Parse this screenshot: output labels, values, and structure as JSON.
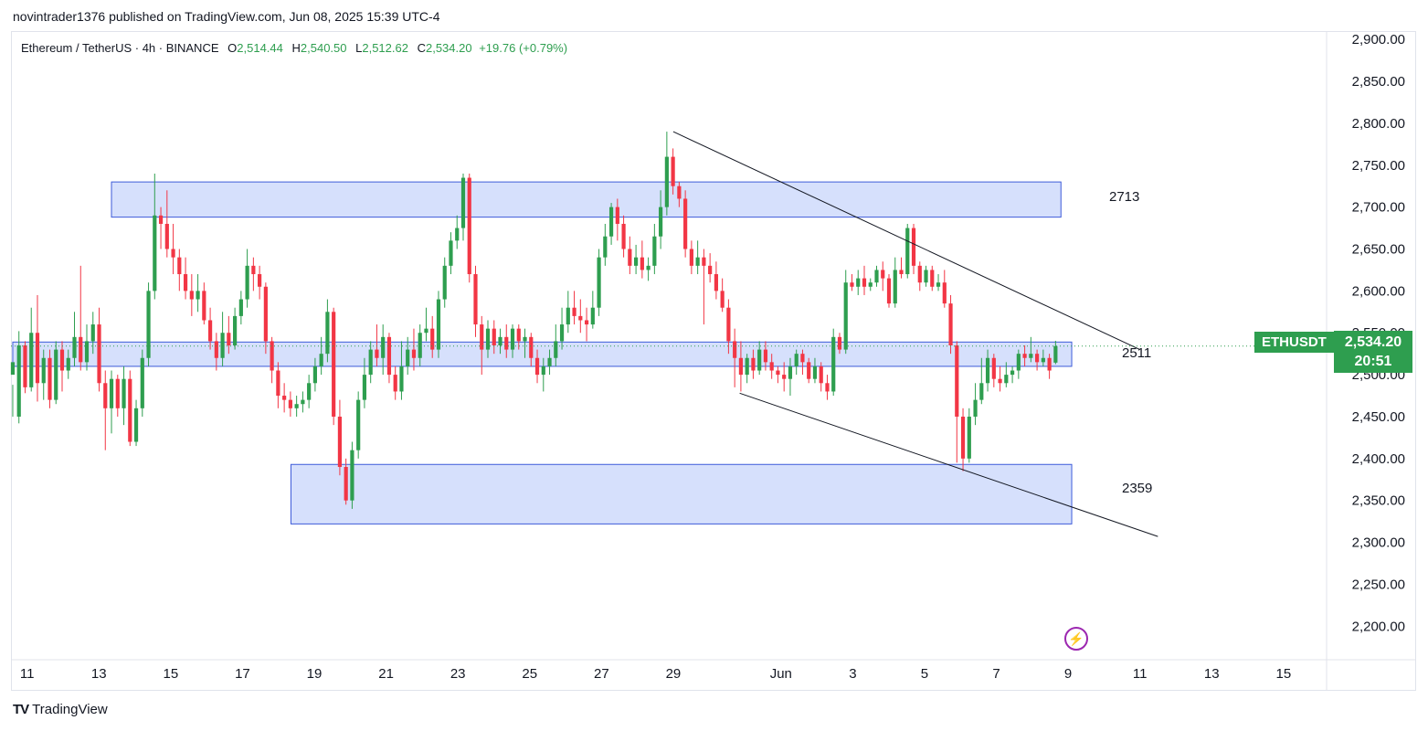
{
  "publish_info": "novintrader1376 published on TradingView.com, Jun 08, 2025 15:39 UTC-4",
  "symbol": {
    "name": "Ethereum / TetherUS · 4h · BINANCE",
    "open_label": "O",
    "open": "2,514.44",
    "high_label": "H",
    "high": "2,540.50",
    "low_label": "L",
    "low": "2,512.62",
    "close_label": "C",
    "close": "2,534.20",
    "change": "+19.76 (+0.79%)"
  },
  "price_tag": {
    "ticker": "ETHUSDT",
    "price": "2,534.20",
    "countdown": "20:51"
  },
  "footer": {
    "brand": "TradingView"
  },
  "colors": {
    "up": "#2e9e4f",
    "down": "#f23645",
    "zone_fill": "#d2ddfc",
    "zone_stroke": "#3d5bd9",
    "accent": "#2e9e4f"
  },
  "icons": {
    "alert": "bolt-icon",
    "logo": "tradingview-logo-icon"
  },
  "chart_data": {
    "type": "candlestick",
    "title": "Ethereum / TetherUS · 4h · BINANCE",
    "ylim": [
      2160,
      2910
    ],
    "y_ticks": [
      "2,900.00",
      "2,850.00",
      "2,800.00",
      "2,750.00",
      "2,700.00",
      "2,650.00",
      "2,600.00",
      "2,550.00",
      "2,500.00",
      "2,450.00",
      "2,400.00",
      "2,350.00",
      "2,300.00",
      "2,250.00",
      "2,200.00"
    ],
    "y_tick_values": [
      2900,
      2850,
      2800,
      2750,
      2700,
      2650,
      2600,
      2550,
      2500,
      2450,
      2400,
      2350,
      2300,
      2250,
      2200
    ],
    "x_tick_labels": [
      "11",
      "13",
      "15",
      "17",
      "19",
      "21",
      "23",
      "25",
      "27",
      "29",
      "Jun",
      "3",
      "5",
      "7",
      "9",
      "11",
      "13",
      "15"
    ],
    "x_tick_days": [
      11,
      13,
      15,
      17,
      19,
      21,
      23,
      25,
      27,
      29,
      32,
      34,
      36,
      38,
      40,
      42,
      44,
      46
    ],
    "x_range_days": [
      10.55,
      47.2
    ],
    "zones": [
      {
        "label": "2713",
        "low": 2688,
        "high": 2730,
        "from_day": 13.35,
        "to_day": 39.8
      },
      {
        "label": "2511",
        "low": 2510,
        "high": 2539,
        "from_day": 10.6,
        "to_day": 40.1
      },
      {
        "label": "2359",
        "low": 2322,
        "high": 2393,
        "from_day": 18.35,
        "to_day": 40.1
      }
    ],
    "trendlines": [
      {
        "from": {
          "day": 29.0,
          "price": 2790
        },
        "to": {
          "day": 42.0,
          "price": 2530
        }
      },
      {
        "from": {
          "day": 30.85,
          "price": 2478
        },
        "to": {
          "day": 42.5,
          "price": 2307
        }
      }
    ],
    "last_price": 2534.2,
    "candles": [
      [
        2500,
        2515,
        2488,
        2450
      ],
      [
        2450,
        2535,
        2552,
        2442
      ],
      [
        2535,
        2485,
        2540,
        2478
      ],
      [
        2485,
        2550,
        2580,
        2480
      ],
      [
        2550,
        2490,
        2595,
        2468
      ],
      [
        2490,
        2520,
        2530,
        2470
      ],
      [
        2520,
        2470,
        2530,
        2460
      ],
      [
        2470,
        2530,
        2540,
        2465
      ],
      [
        2530,
        2505,
        2540,
        2480
      ],
      [
        2505,
        2520,
        2530,
        2495
      ],
      [
        2520,
        2545,
        2575,
        2510
      ],
      [
        2545,
        2515,
        2630,
        2505
      ],
      [
        2515,
        2540,
        2560,
        2505
      ],
      [
        2540,
        2560,
        2575,
        2525
      ],
      [
        2560,
        2490,
        2580,
        2480
      ],
      [
        2490,
        2460,
        2505,
        2410
      ],
      [
        2460,
        2495,
        2505,
        2430
      ],
      [
        2495,
        2460,
        2500,
        2450
      ],
      [
        2460,
        2495,
        2510,
        2440
      ],
      [
        2495,
        2420,
        2505,
        2415
      ],
      [
        2420,
        2460,
        2470,
        2415
      ],
      [
        2460,
        2520,
        2530,
        2450
      ],
      [
        2520,
        2600,
        2610,
        2510
      ],
      [
        2600,
        2690,
        2740,
        2590
      ],
      [
        2690,
        2680,
        2700,
        2650
      ],
      [
        2680,
        2650,
        2720,
        2640
      ],
      [
        2650,
        2640,
        2680,
        2620
      ],
      [
        2640,
        2620,
        2650,
        2600
      ],
      [
        2620,
        2600,
        2640,
        2590
      ],
      [
        2600,
        2590,
        2620,
        2570
      ],
      [
        2590,
        2600,
        2620,
        2575
      ],
      [
        2600,
        2565,
        2610,
        2560
      ],
      [
        2565,
        2540,
        2580,
        2530
      ],
      [
        2540,
        2520,
        2550,
        2505
      ],
      [
        2520,
        2550,
        2575,
        2510
      ],
      [
        2550,
        2535,
        2570,
        2525
      ],
      [
        2535,
        2570,
        2580,
        2530
      ],
      [
        2570,
        2590,
        2600,
        2560
      ],
      [
        2590,
        2630,
        2650,
        2580
      ],
      [
        2630,
        2620,
        2640,
        2600
      ],
      [
        2620,
        2605,
        2630,
        2590
      ],
      [
        2605,
        2540,
        2610,
        2525
      ],
      [
        2540,
        2505,
        2545,
        2490
      ],
      [
        2505,
        2475,
        2515,
        2460
      ],
      [
        2475,
        2470,
        2490,
        2455
      ],
      [
        2470,
        2460,
        2480,
        2450
      ],
      [
        2460,
        2465,
        2475,
        2450
      ],
      [
        2465,
        2470,
        2480,
        2455
      ],
      [
        2470,
        2490,
        2500,
        2460
      ],
      [
        2490,
        2510,
        2520,
        2480
      ],
      [
        2510,
        2525,
        2545,
        2500
      ],
      [
        2525,
        2575,
        2590,
        2515
      ],
      [
        2575,
        2450,
        2580,
        2440
      ],
      [
        2450,
        2390,
        2470,
        2380
      ],
      [
        2390,
        2350,
        2400,
        2345
      ],
      [
        2350,
        2410,
        2420,
        2340
      ],
      [
        2410,
        2470,
        2480,
        2400
      ],
      [
        2470,
        2500,
        2520,
        2460
      ],
      [
        2500,
        2530,
        2540,
        2490
      ],
      [
        2530,
        2520,
        2560,
        2510
      ],
      [
        2520,
        2545,
        2560,
        2500
      ],
      [
        2545,
        2500,
        2550,
        2490
      ],
      [
        2500,
        2480,
        2510,
        2470
      ],
      [
        2480,
        2510,
        2540,
        2470
      ],
      [
        2510,
        2530,
        2545,
        2500
      ],
      [
        2530,
        2520,
        2555,
        2505
      ],
      [
        2520,
        2550,
        2560,
        2510
      ],
      [
        2550,
        2555,
        2580,
        2540
      ],
      [
        2555,
        2530,
        2570,
        2520
      ],
      [
        2530,
        2590,
        2600,
        2520
      ],
      [
        2590,
        2630,
        2640,
        2580
      ],
      [
        2630,
        2660,
        2670,
        2620
      ],
      [
        2660,
        2675,
        2690,
        2650
      ],
      [
        2675,
        2735,
        2740,
        2660
      ],
      [
        2735,
        2620,
        2740,
        2610
      ],
      [
        2620,
        2560,
        2630,
        2545
      ],
      [
        2560,
        2530,
        2570,
        2500
      ],
      [
        2530,
        2555,
        2565,
        2520
      ],
      [
        2555,
        2535,
        2565,
        2525
      ],
      [
        2535,
        2545,
        2555,
        2525
      ],
      [
        2545,
        2530,
        2560,
        2520
      ],
      [
        2530,
        2555,
        2560,
        2520
      ],
      [
        2555,
        2540,
        2560,
        2530
      ],
      [
        2540,
        2545,
        2555,
        2520
      ],
      [
        2545,
        2520,
        2550,
        2510
      ],
      [
        2520,
        2500,
        2530,
        2490
      ],
      [
        2500,
        2510,
        2520,
        2480
      ],
      [
        2510,
        2520,
        2530,
        2500
      ],
      [
        2520,
        2540,
        2560,
        2510
      ],
      [
        2540,
        2560,
        2580,
        2530
      ],
      [
        2560,
        2580,
        2600,
        2550
      ],
      [
        2580,
        2570,
        2600,
        2560
      ],
      [
        2570,
        2565,
        2590,
        2550
      ],
      [
        2565,
        2560,
        2580,
        2540
      ],
      [
        2560,
        2580,
        2600,
        2555
      ],
      [
        2580,
        2640,
        2650,
        2570
      ],
      [
        2640,
        2665,
        2680,
        2630
      ],
      [
        2665,
        2700,
        2705,
        2655
      ],
      [
        2700,
        2680,
        2710,
        2660
      ],
      [
        2680,
        2650,
        2690,
        2640
      ],
      [
        2650,
        2630,
        2665,
        2620
      ],
      [
        2630,
        2640,
        2655,
        2620
      ],
      [
        2640,
        2625,
        2660,
        2615
      ],
      [
        2625,
        2630,
        2640,
        2612
      ],
      [
        2630,
        2665,
        2680,
        2620
      ],
      [
        2665,
        2700,
        2720,
        2650
      ],
      [
        2700,
        2760,
        2790,
        2690
      ],
      [
        2760,
        2725,
        2770,
        2715
      ],
      [
        2725,
        2710,
        2730,
        2700
      ],
      [
        2710,
        2650,
        2720,
        2640
      ],
      [
        2650,
        2630,
        2660,
        2620
      ],
      [
        2630,
        2640,
        2660,
        2620
      ],
      [
        2640,
        2630,
        2650,
        2560
      ],
      [
        2630,
        2620,
        2645,
        2610
      ],
      [
        2620,
        2600,
        2635,
        2590
      ],
      [
        2600,
        2580,
        2615,
        2575
      ],
      [
        2580,
        2540,
        2590,
        2525
      ],
      [
        2540,
        2520,
        2555,
        2485
      ],
      [
        2520,
        2500,
        2540,
        2480
      ],
      [
        2500,
        2520,
        2525,
        2490
      ],
      [
        2520,
        2505,
        2530,
        2495
      ],
      [
        2505,
        2530,
        2540,
        2500
      ],
      [
        2530,
        2515,
        2540,
        2505
      ],
      [
        2515,
        2505,
        2525,
        2495
      ],
      [
        2505,
        2500,
        2510,
        2490
      ],
      [
        2500,
        2495,
        2515,
        2480
      ],
      [
        2495,
        2510,
        2520,
        2475
      ],
      [
        2510,
        2525,
        2530,
        2500
      ],
      [
        2525,
        2515,
        2530,
        2500
      ],
      [
        2515,
        2495,
        2520,
        2490
      ],
      [
        2495,
        2510,
        2520,
        2490
      ],
      [
        2510,
        2490,
        2515,
        2480
      ],
      [
        2490,
        2480,
        2500,
        2470
      ],
      [
        2480,
        2545,
        2555,
        2475
      ],
      [
        2545,
        2530,
        2550,
        2525
      ],
      [
        2530,
        2610,
        2625,
        2525
      ],
      [
        2610,
        2605,
        2620,
        2600
      ],
      [
        2605,
        2615,
        2625,
        2595
      ],
      [
        2615,
        2605,
        2630,
        2595
      ],
      [
        2605,
        2610,
        2615,
        2600
      ],
      [
        2610,
        2625,
        2630,
        2605
      ],
      [
        2625,
        2615,
        2635,
        2600
      ],
      [
        2615,
        2585,
        2620,
        2580
      ],
      [
        2585,
        2625,
        2640,
        2580
      ],
      [
        2625,
        2620,
        2640,
        2615
      ],
      [
        2620,
        2675,
        2680,
        2615
      ],
      [
        2675,
        2630,
        2680,
        2620
      ],
      [
        2630,
        2610,
        2635,
        2600
      ],
      [
        2610,
        2625,
        2630,
        2605
      ],
      [
        2625,
        2605,
        2630,
        2600
      ],
      [
        2605,
        2610,
        2620,
        2600
      ],
      [
        2610,
        2585,
        2625,
        2580
      ],
      [
        2585,
        2535,
        2595,
        2525
      ],
      [
        2535,
        2450,
        2540,
        2395
      ],
      [
        2450,
        2400,
        2460,
        2385
      ],
      [
        2400,
        2450,
        2460,
        2395
      ],
      [
        2450,
        2470,
        2490,
        2440
      ],
      [
        2470,
        2490,
        2520,
        2465
      ],
      [
        2490,
        2520,
        2530,
        2480
      ],
      [
        2520,
        2495,
        2525,
        2485
      ],
      [
        2495,
        2490,
        2510,
        2480
      ],
      [
        2490,
        2500,
        2515,
        2485
      ],
      [
        2500,
        2505,
        2510,
        2490
      ],
      [
        2505,
        2525,
        2530,
        2495
      ],
      [
        2525,
        2520,
        2535,
        2510
      ],
      [
        2520,
        2525,
        2545,
        2515
      ],
      [
        2525,
        2515,
        2530,
        2505
      ],
      [
        2515,
        2520,
        2530,
        2510
      ],
      [
        2520,
        2505,
        2525,
        2495
      ],
      [
        2514.44,
        2534.2,
        2540.5,
        2512.62
      ]
    ]
  }
}
